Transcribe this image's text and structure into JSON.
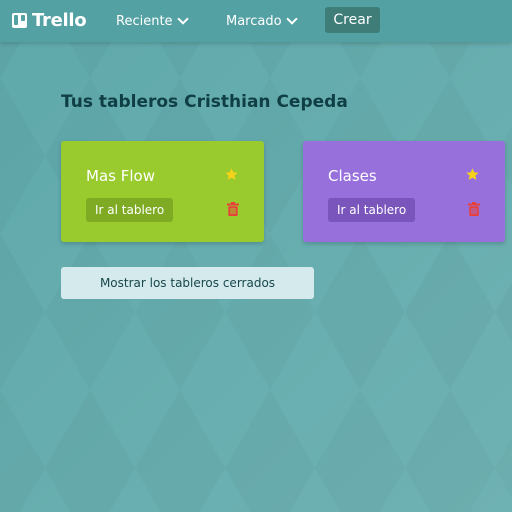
{
  "app": {
    "logo_text": "Trello"
  },
  "nav": {
    "recent_label": "Reciente",
    "starred_label": "Marcado",
    "create_label": "Crear"
  },
  "main": {
    "title": "Tus tableros Cristhian Cepeda",
    "boards": [
      {
        "name": "Mas Flow",
        "open_label": "Ir al tablero",
        "starred": true,
        "color": "#99cb2e"
      },
      {
        "name": "Clases",
        "open_label": "Ir al tablero",
        "starred": true,
        "color": "#9770db"
      }
    ],
    "show_closed_label": "Mostrar los tableros cerrados"
  },
  "colors": {
    "header": "#54a1a3",
    "background": "#5fa9ab",
    "create_button": "#3e7d78",
    "star": "#f7d21b",
    "trash": "#e8403a",
    "title": "#0f3f45"
  },
  "icons": {
    "logo": "trello-board-icon",
    "dropdown": "chevron-down-icon",
    "star": "star-icon",
    "delete": "trash-icon"
  }
}
